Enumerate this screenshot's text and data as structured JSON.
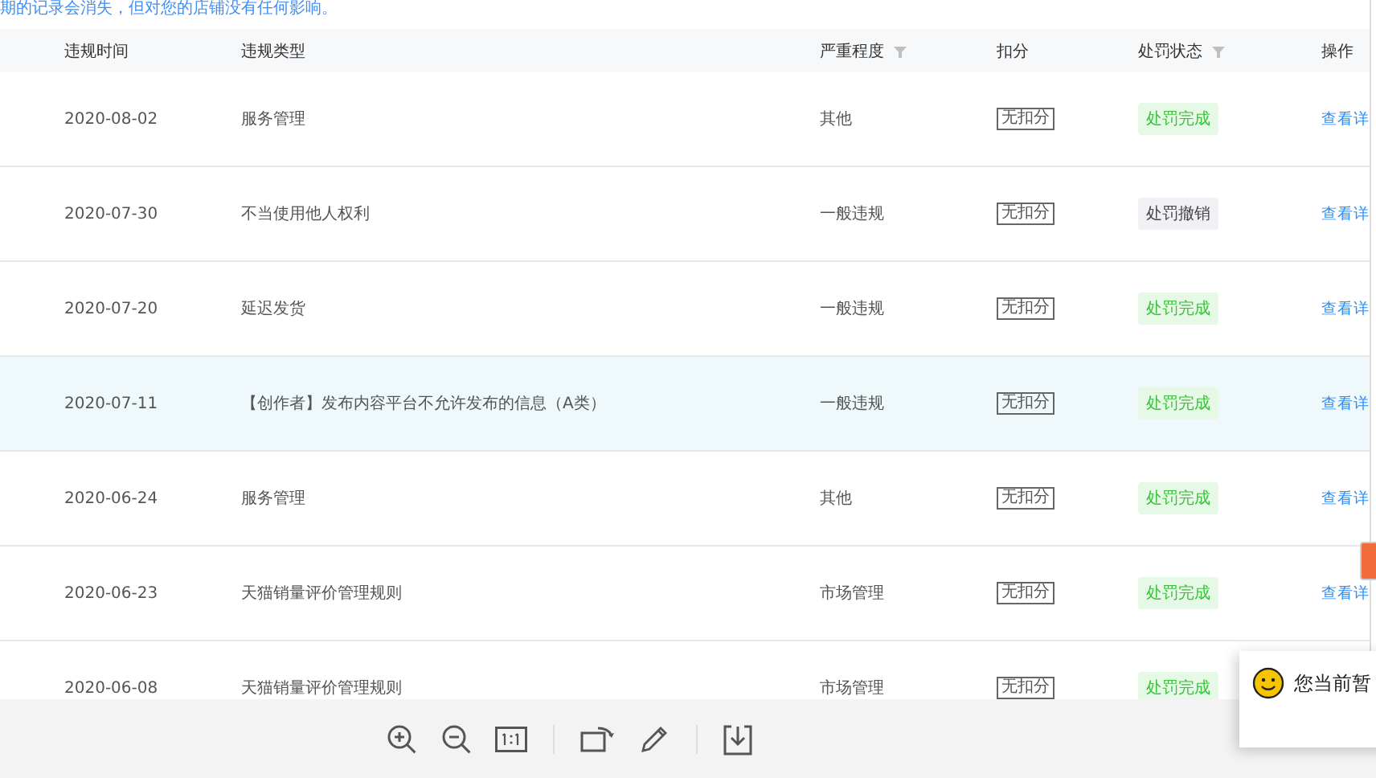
{
  "notice": "期的记录会消失，但对您的店铺没有任何影响。",
  "table": {
    "columns": [
      {
        "label": "违规时间",
        "filter": false
      },
      {
        "label": "违规类型",
        "filter": false
      },
      {
        "label": "严重程度",
        "filter": true
      },
      {
        "label": "扣分",
        "filter": false
      },
      {
        "label": "处罚状态",
        "filter": true
      },
      {
        "label": "操作",
        "filter": false
      }
    ],
    "rows": [
      {
        "date": "2020-08-02",
        "type": "服务管理",
        "severity": "其他",
        "score": "无扣分",
        "status": {
          "label": "处罚完成",
          "kind": "done"
        },
        "action": "查看详",
        "hovered": false
      },
      {
        "date": "2020-07-30",
        "type": "不当使用他人权利",
        "severity": "一般违规",
        "score": "无扣分",
        "status": {
          "label": "处罚撤销",
          "kind": "revoked"
        },
        "action": "查看详",
        "hovered": false
      },
      {
        "date": "2020-07-20",
        "type": "延迟发货",
        "severity": "一般违规",
        "score": "无扣分",
        "status": {
          "label": "处罚完成",
          "kind": "done"
        },
        "action": "查看详",
        "hovered": false
      },
      {
        "date": "2020-07-11",
        "type": "【创作者】发布内容平台不允许发布的信息（A类）",
        "severity": "一般违规",
        "score": "无扣分",
        "status": {
          "label": "处罚完成",
          "kind": "done"
        },
        "action": "查看详",
        "hovered": true
      },
      {
        "date": "2020-06-24",
        "type": "服务管理",
        "severity": "其他",
        "score": "无扣分",
        "status": {
          "label": "处罚完成",
          "kind": "done"
        },
        "action": "查看详",
        "hovered": false
      },
      {
        "date": "2020-06-23",
        "type": "天猫销量评价管理规则",
        "severity": "市场管理",
        "score": "无扣分",
        "status": {
          "label": "处罚完成",
          "kind": "done"
        },
        "action": "查看详",
        "hovered": false
      },
      {
        "date": "2020-06-08",
        "type": "天猫销量评价管理规则",
        "severity": "市场管理",
        "score": "无扣分",
        "status": {
          "label": "处罚完成",
          "kind": "done"
        },
        "action": "",
        "hovered": false
      }
    ]
  },
  "chat_popup": {
    "text": "您当前暂"
  }
}
